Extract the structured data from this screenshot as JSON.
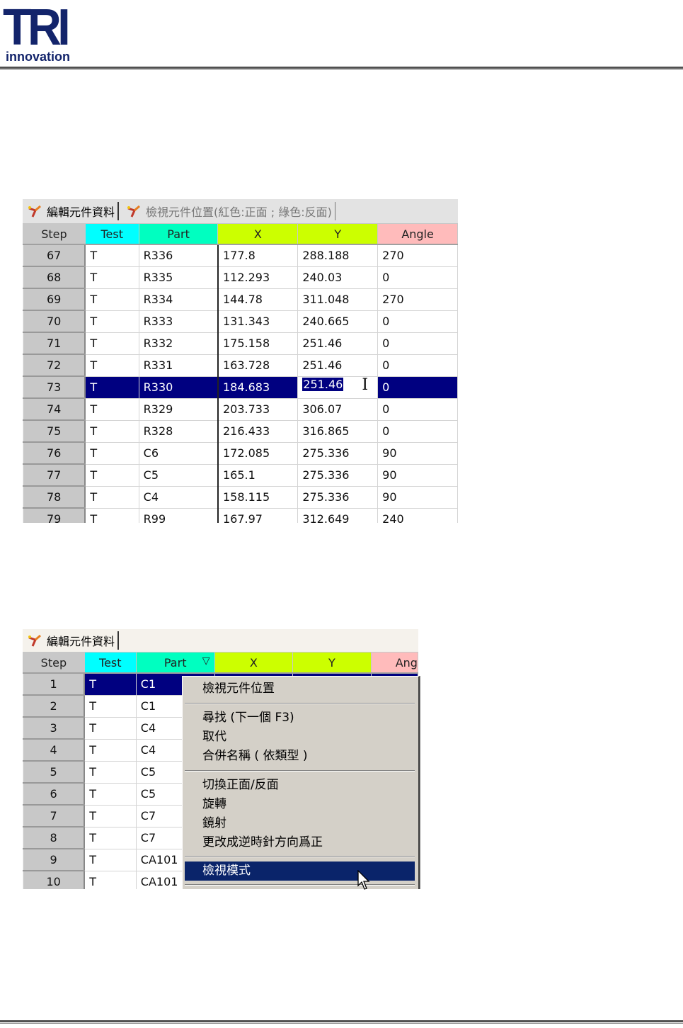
{
  "logo": {
    "brand": "TRI",
    "tagline": "innovation"
  },
  "panel1": {
    "tabs": [
      {
        "label": "編輯元件資料",
        "icon": "wand-icon"
      },
      {
        "label": "檢視元件位置(紅色:正面 ; 綠色:反面)",
        "icon": "wand-icon"
      }
    ],
    "columns": [
      "Step",
      "Test",
      "Part",
      "X",
      "Y",
      "Angle"
    ],
    "column_colors": {
      "Step": "#c8c8c8",
      "Test": "#00ffff",
      "Part": "#00ffc0",
      "X": "#ccff00",
      "Y": "#ccff00",
      "Angle": "#ffbbbb"
    },
    "rows": [
      [
        "67",
        "T",
        "R336",
        "177.8",
        "288.188",
        "270"
      ],
      [
        "68",
        "T",
        "R335",
        "112.293",
        "240.03",
        "0"
      ],
      [
        "69",
        "T",
        "R334",
        "144.78",
        "311.048",
        "270"
      ],
      [
        "70",
        "T",
        "R333",
        "131.343",
        "240.665",
        "0"
      ],
      [
        "71",
        "T",
        "R332",
        "175.158",
        "251.46",
        "0"
      ],
      [
        "72",
        "T",
        "R331",
        "163.728",
        "251.46",
        "0"
      ],
      [
        "73",
        "T",
        "R330",
        "184.683",
        "251.46",
        "0"
      ],
      [
        "74",
        "T",
        "R329",
        "203.733",
        "306.07",
        "0"
      ],
      [
        "75",
        "T",
        "R328",
        "216.433",
        "316.865",
        "0"
      ],
      [
        "76",
        "T",
        "C6",
        "172.085",
        "275.336",
        "90"
      ],
      [
        "77",
        "T",
        "C5",
        "165.1",
        "275.336",
        "90"
      ],
      [
        "78",
        "T",
        "C4",
        "158.115",
        "275.336",
        "90"
      ],
      [
        "79",
        "T",
        "R99",
        "167.97",
        "312.649",
        "240"
      ]
    ],
    "selected_step": "73",
    "editing_cell": {
      "column": "Y",
      "value": "251.46"
    }
  },
  "panel2": {
    "tabs": [
      {
        "label": "編輯元件資料",
        "icon": "wand-icon"
      }
    ],
    "columns": [
      "Step",
      "Test",
      "Part",
      "X",
      "Y",
      "Ang"
    ],
    "rows": [
      [
        "1",
        "T",
        "C1"
      ],
      [
        "2",
        "T",
        "C1"
      ],
      [
        "3",
        "T",
        "C4"
      ],
      [
        "4",
        "T",
        "C4"
      ],
      [
        "5",
        "T",
        "C5"
      ],
      [
        "6",
        "T",
        "C5"
      ],
      [
        "7",
        "T",
        "C7"
      ],
      [
        "8",
        "T",
        "C7"
      ],
      [
        "9",
        "T",
        "CA101"
      ],
      [
        "10",
        "T",
        "CA101"
      ]
    ],
    "selected_step": "1",
    "filter_icon": "filter-icon"
  },
  "context_menu": {
    "groups": [
      [
        "檢視元件位置"
      ],
      [
        "尋找 (下一個  F3)",
        "取代",
        "合併名稱 ( 依類型 )"
      ],
      [
        "切換正面/反面",
        "旋轉",
        "鏡射",
        "更改成逆時針方向爲正"
      ],
      [
        "檢視模式"
      ]
    ],
    "highlighted": "檢視模式",
    "highlight_color": "#0a246a"
  }
}
